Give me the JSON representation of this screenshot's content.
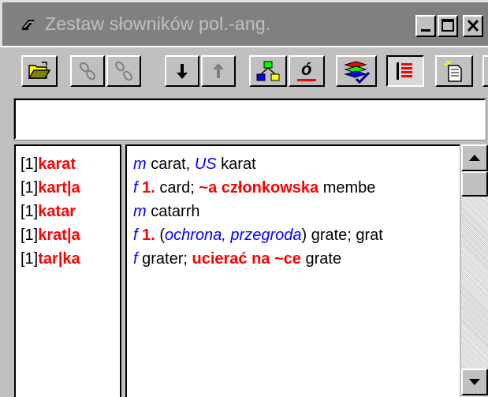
{
  "window": {
    "title": "Zestaw słowników pol.-ang.",
    "controls": [
      "minimize",
      "maximize",
      "close"
    ]
  },
  "toolbar": {
    "buttons": [
      {
        "icon": "open-folder-icon",
        "enabled": true
      },
      {
        "icon": "link-icon",
        "enabled": false
      },
      {
        "icon": "unlink-icon",
        "enabled": false
      },
      {
        "icon": "arrow-down-icon",
        "enabled": true
      },
      {
        "icon": "arrow-up-icon",
        "enabled": false
      },
      {
        "icon": "hierarchy-icon",
        "enabled": true
      },
      {
        "icon": "accent-o-icon",
        "label": "ó",
        "enabled": true
      },
      {
        "icon": "books-check-icon",
        "enabled": true
      },
      {
        "icon": "list-view-icon",
        "enabled": true,
        "pressed": true
      },
      {
        "icon": "new-document-icon",
        "enabled": true
      }
    ]
  },
  "search": {
    "value": "",
    "placeholder": ""
  },
  "entries": [
    {
      "index": "[1]",
      "headword": "karat"
    },
    {
      "index": "[1]",
      "headword": "kart|a"
    },
    {
      "index": "[1]",
      "headword": "katar"
    },
    {
      "index": "[1]",
      "headword": "krat|a"
    },
    {
      "index": "[1]",
      "headword": "tar|ka"
    }
  ],
  "definitions": [
    {
      "pos": "m",
      "t1": " carat, ",
      "t2": "US",
      "t3": " karat"
    },
    {
      "pos": "f",
      "num": " 1.",
      "t1": " card; ",
      "phrase": "~a członkowska",
      "t3": " membe"
    },
    {
      "pos": "m",
      "t1": " catarrh"
    },
    {
      "pos": "f",
      "num": " 1.",
      "t1": " (",
      "note": "ochrona, przegroda",
      "t3": ") grate; grat"
    },
    {
      "pos": "f",
      "t1": " grater; ",
      "phrase": "ucierać na ~ce",
      "t3": " grate"
    }
  ],
  "colors": {
    "headword": "#ff0000",
    "pos": "#0000ff",
    "titlebar_inactive": "#808080",
    "face": "#c0c0c0"
  }
}
